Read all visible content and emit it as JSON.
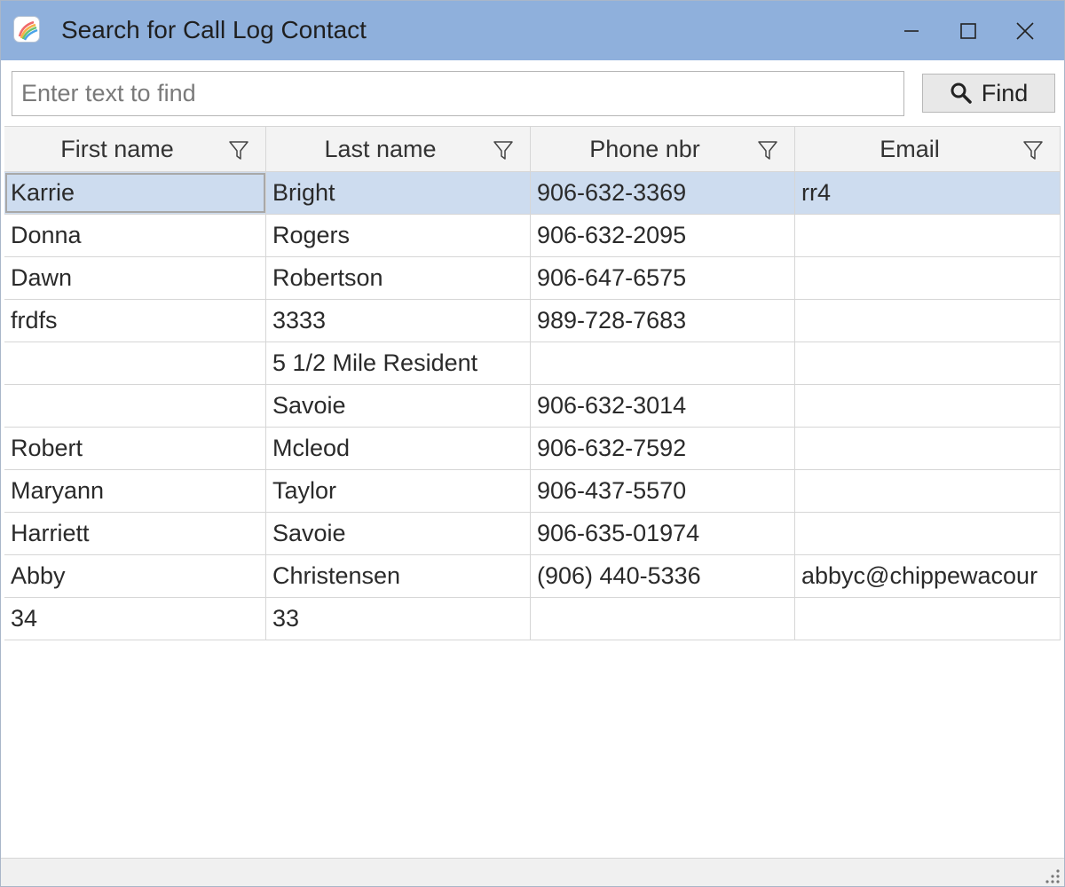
{
  "window": {
    "title": "Search for Call Log Contact",
    "controls": {
      "minimize": "minimize-icon",
      "maximize": "maximize-icon",
      "close": "close-icon"
    }
  },
  "search": {
    "value": "",
    "placeholder": "Enter text to find",
    "find_label": "Find"
  },
  "grid": {
    "columns": [
      {
        "label": "First name"
      },
      {
        "label": "Last name"
      },
      {
        "label": "Phone nbr"
      },
      {
        "label": "Email"
      }
    ],
    "rows": [
      [
        "Karrie",
        "Bright",
        "906-632-3369",
        "rr4"
      ],
      [
        "Donna",
        "Rogers",
        "906-632-2095",
        ""
      ],
      [
        "Dawn",
        "Robertson",
        "906-647-6575",
        ""
      ],
      [
        "frdfs",
        "3333",
        "989-728-7683",
        ""
      ],
      [
        "",
        "5 1/2 Mile Resident",
        "",
        ""
      ],
      [
        "",
        "Savoie",
        "906-632-3014",
        ""
      ],
      [
        "Robert",
        "Mcleod",
        "906-632-7592",
        ""
      ],
      [
        "Maryann",
        "Taylor",
        "906-437-5570",
        ""
      ],
      [
        "Harriett",
        "Savoie",
        "906-635-01974",
        ""
      ],
      [
        "Abby",
        "Christensen",
        "(906) 440-5336",
        "abbyc@chippewacour"
      ],
      [
        "34",
        "33",
        "",
        ""
      ]
    ],
    "selected_row": 0
  },
  "colors": {
    "titlebar": "#8fb0dc",
    "selected_row": "#cddcef"
  }
}
